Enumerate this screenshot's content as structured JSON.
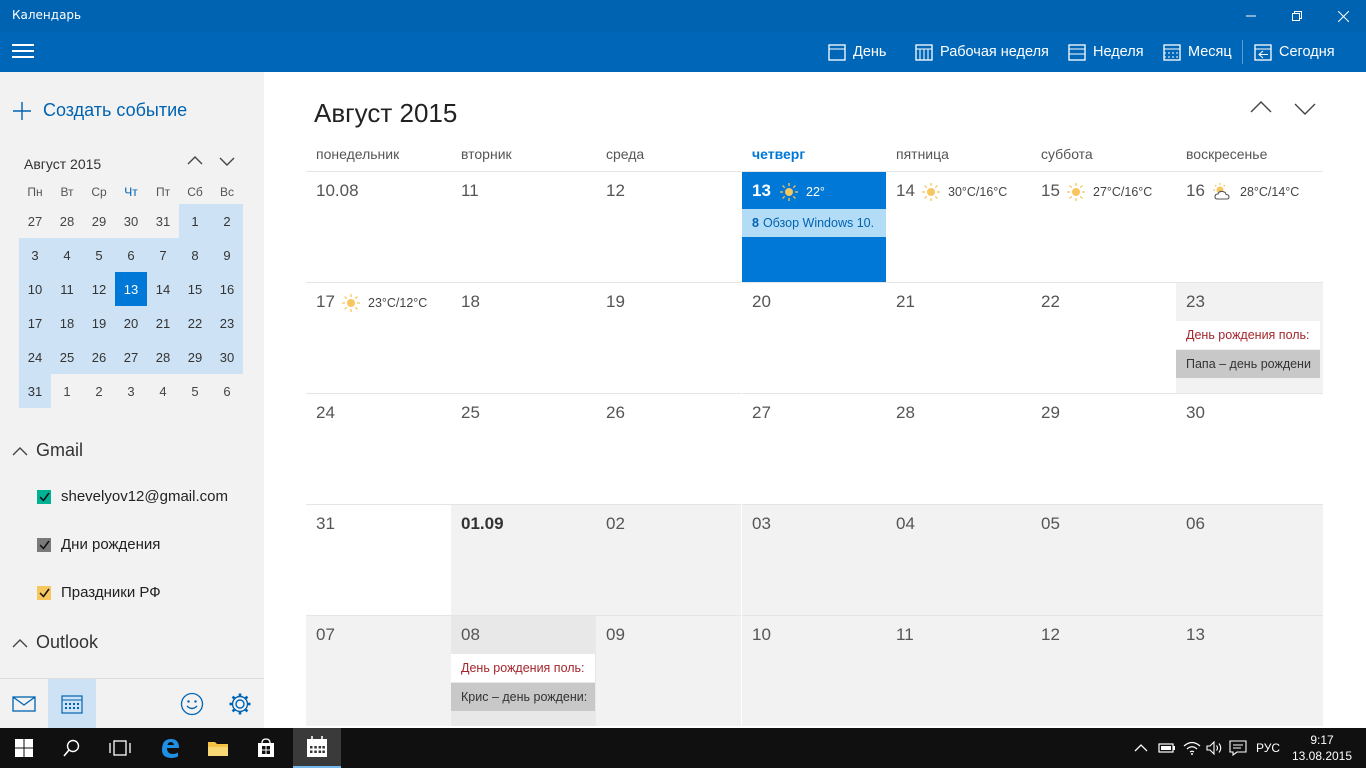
{
  "window": {
    "title": "Календарь"
  },
  "toolbar": {
    "day": "День",
    "workweek": "Рабочая неделя",
    "week": "Неделя",
    "month": "Месяц",
    "today": "Сегодня"
  },
  "sidebar": {
    "new_event": "Создать событие",
    "mini_title": "Август 2015",
    "weekdays": [
      "Пн",
      "Вт",
      "Ср",
      "Чт",
      "Пт",
      "Сб",
      "Вс"
    ],
    "weeks": [
      [
        "27",
        "28",
        "29",
        "30",
        "31",
        "1",
        "2"
      ],
      [
        "3",
        "4",
        "5",
        "6",
        "7",
        "8",
        "9"
      ],
      [
        "10",
        "11",
        "12",
        "13",
        "14",
        "15",
        "16"
      ],
      [
        "17",
        "18",
        "19",
        "20",
        "21",
        "22",
        "23"
      ],
      [
        "24",
        "25",
        "26",
        "27",
        "28",
        "29",
        "30"
      ],
      [
        "31",
        "1",
        "2",
        "3",
        "4",
        "5",
        "6"
      ]
    ],
    "gmail_group": "Gmail",
    "calendars": [
      {
        "label": "shevelyov12@gmail.com",
        "color": "#00b294"
      },
      {
        "label": "Дни рождения",
        "color": "#7a7a7a"
      },
      {
        "label": "Праздники РФ",
        "color": "#f7c65f"
      }
    ],
    "outlook_group": "Outlook"
  },
  "main": {
    "month_title": "Август 2015",
    "days_of_week": [
      "понедельник",
      "вторник",
      "среда",
      "четверг",
      "пятница",
      "суббота",
      "воскресенье"
    ],
    "weeks": [
      [
        "10.08",
        "11",
        "12",
        "13",
        "14",
        "15",
        "16"
      ],
      [
        "17",
        "18",
        "19",
        "20",
        "21",
        "22",
        "23"
      ],
      [
        "24",
        "25",
        "26",
        "27",
        "28",
        "29",
        "30"
      ],
      [
        "31",
        "01.09",
        "02",
        "03",
        "04",
        "05",
        "06"
      ],
      [
        "07",
        "08",
        "09",
        "10",
        "11",
        "12",
        "13"
      ]
    ],
    "weather": {
      "thu13": "22°",
      "fri14": "30°C/16°C",
      "sat15": "27°C/16°C",
      "sun16": "28°C/14°C",
      "mon17": "23°C/12°C"
    },
    "events": {
      "windows_num": "8",
      "windows": "Обзор Windows 10.",
      "bday_user_23": "День рождения поль:",
      "bday_papa": "Папа – день рождени",
      "bday_user_08": "День рождения поль:",
      "bday_kris": "Крис – день рождени:"
    }
  },
  "taskbar": {
    "lang": "РУС",
    "time": "9:17",
    "date": "13.08.2015"
  },
  "colors": {
    "accent": "#0078d7",
    "titlebar": "#0063b1",
    "today_bg": "#0078d7"
  }
}
